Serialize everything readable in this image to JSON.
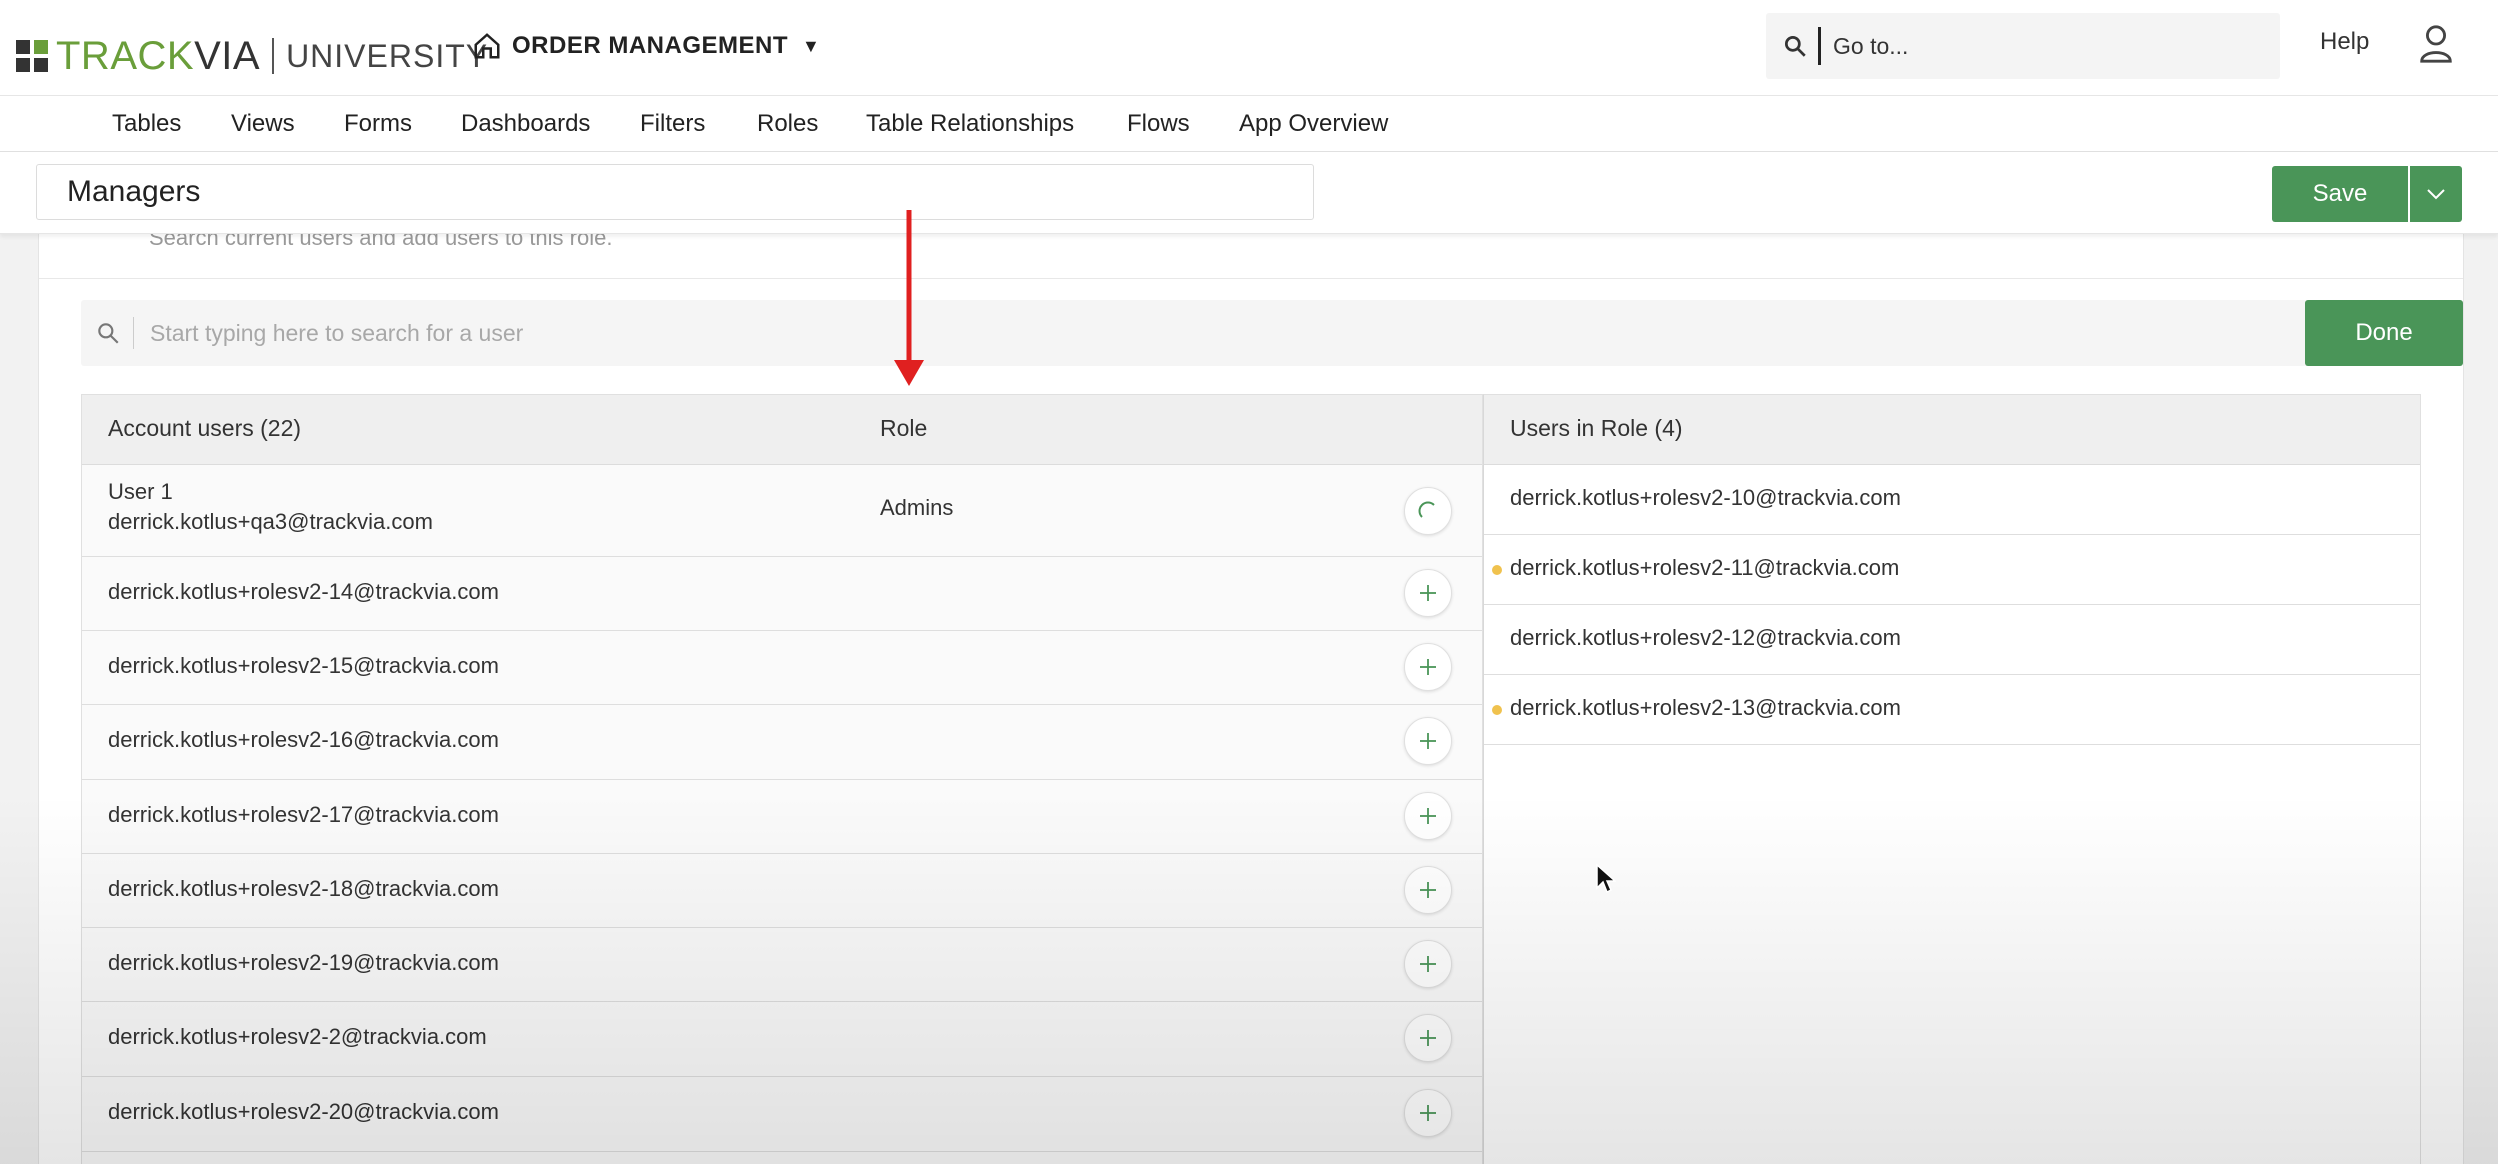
{
  "header": {
    "logo": {
      "track": "TRACK",
      "via": "VIA",
      "university": "UNIVERSITY"
    },
    "app_name": "ORDER MANAGEMENT",
    "app_caret": "▼",
    "goto_placeholder": "Go to...",
    "help_label": "Help",
    "colors": {
      "brand_green": "#6a9e3a",
      "button_green": "#4a9558"
    }
  },
  "nav": {
    "items": [
      "Tables",
      "Views",
      "Forms",
      "Dashboards",
      "Filters",
      "Roles",
      "Table Relationships",
      "Flows",
      "App Overview"
    ]
  },
  "titlebar": {
    "role_name": "Managers",
    "save_label": "Save"
  },
  "panel": {
    "subtitle": "Search current users and add users to this role.",
    "search_placeholder": "Start typing here to search for a user",
    "done_label": "Done"
  },
  "account_users": {
    "header": "Account users (22)",
    "role_header": "Role",
    "rows": [
      {
        "name": "User 1",
        "email": "derrick.kotlus+qa3@trackvia.com",
        "role": "Admins",
        "action": "loading"
      },
      {
        "email": "derrick.kotlus+rolesv2-14@trackvia.com",
        "role": "",
        "action": "add"
      },
      {
        "email": "derrick.kotlus+rolesv2-15@trackvia.com",
        "role": "",
        "action": "add"
      },
      {
        "email": "derrick.kotlus+rolesv2-16@trackvia.com",
        "role": "",
        "action": "add"
      },
      {
        "email": "derrick.kotlus+rolesv2-17@trackvia.com",
        "role": "",
        "action": "add"
      },
      {
        "email": "derrick.kotlus+rolesv2-18@trackvia.com",
        "role": "",
        "action": "add"
      },
      {
        "email": "derrick.kotlus+rolesv2-19@trackvia.com",
        "role": "",
        "action": "add"
      },
      {
        "email": "derrick.kotlus+rolesv2-2@trackvia.com",
        "role": "",
        "action": "add"
      },
      {
        "email": "derrick.kotlus+rolesv2-20@trackvia.com",
        "role": "",
        "action": "add"
      }
    ]
  },
  "users_in_role": {
    "header": "Users in Role (4)",
    "rows": [
      {
        "email": "derrick.kotlus+rolesv2-10@trackvia.com",
        "new": false
      },
      {
        "email": "derrick.kotlus+rolesv2-11@trackvia.com",
        "new": true
      },
      {
        "email": "derrick.kotlus+rolesv2-12@trackvia.com",
        "new": false
      },
      {
        "email": "derrick.kotlus+rolesv2-13@trackvia.com",
        "new": true
      }
    ]
  },
  "annotation": {
    "arrow_color": "#e02020"
  }
}
